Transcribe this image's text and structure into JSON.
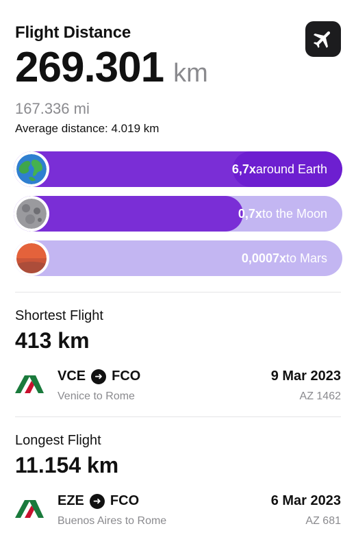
{
  "header": {
    "title": "Flight Distance",
    "total_value": "269.301",
    "total_unit": "km",
    "miles": "167.336 mi",
    "average": "Average distance: 4.019 km",
    "icon": "airplane-icon"
  },
  "comparisons": [
    {
      "value": "6,7x",
      "text": " around Earth",
      "icon": "earth-icon",
      "progress": 1.0
    },
    {
      "value": "0,7x",
      "text": " to the Moon",
      "icon": "moon-icon",
      "progress": 0.7
    },
    {
      "value": "0,0007x",
      "text": " to Mars",
      "icon": "mars-icon",
      "progress": 0.0
    }
  ],
  "shortest": {
    "label": "Shortest Flight",
    "distance": "413 km",
    "from": "VCE",
    "to": "FCO",
    "route_name": "Venice to Rome",
    "date": "9 Mar 2023",
    "flight_no": "AZ 1462"
  },
  "longest": {
    "label": "Longest Flight",
    "distance": "11.154 km",
    "from": "EZE",
    "to": "FCO",
    "route_name": "Buenos Aires to Rome",
    "date": "6 Mar 2023",
    "flight_no": "AZ 681"
  },
  "colors": {
    "bar_fill": "#7a2ed6",
    "bar_track": "#c3b6f2",
    "muted_text": "#8a8a8e"
  }
}
